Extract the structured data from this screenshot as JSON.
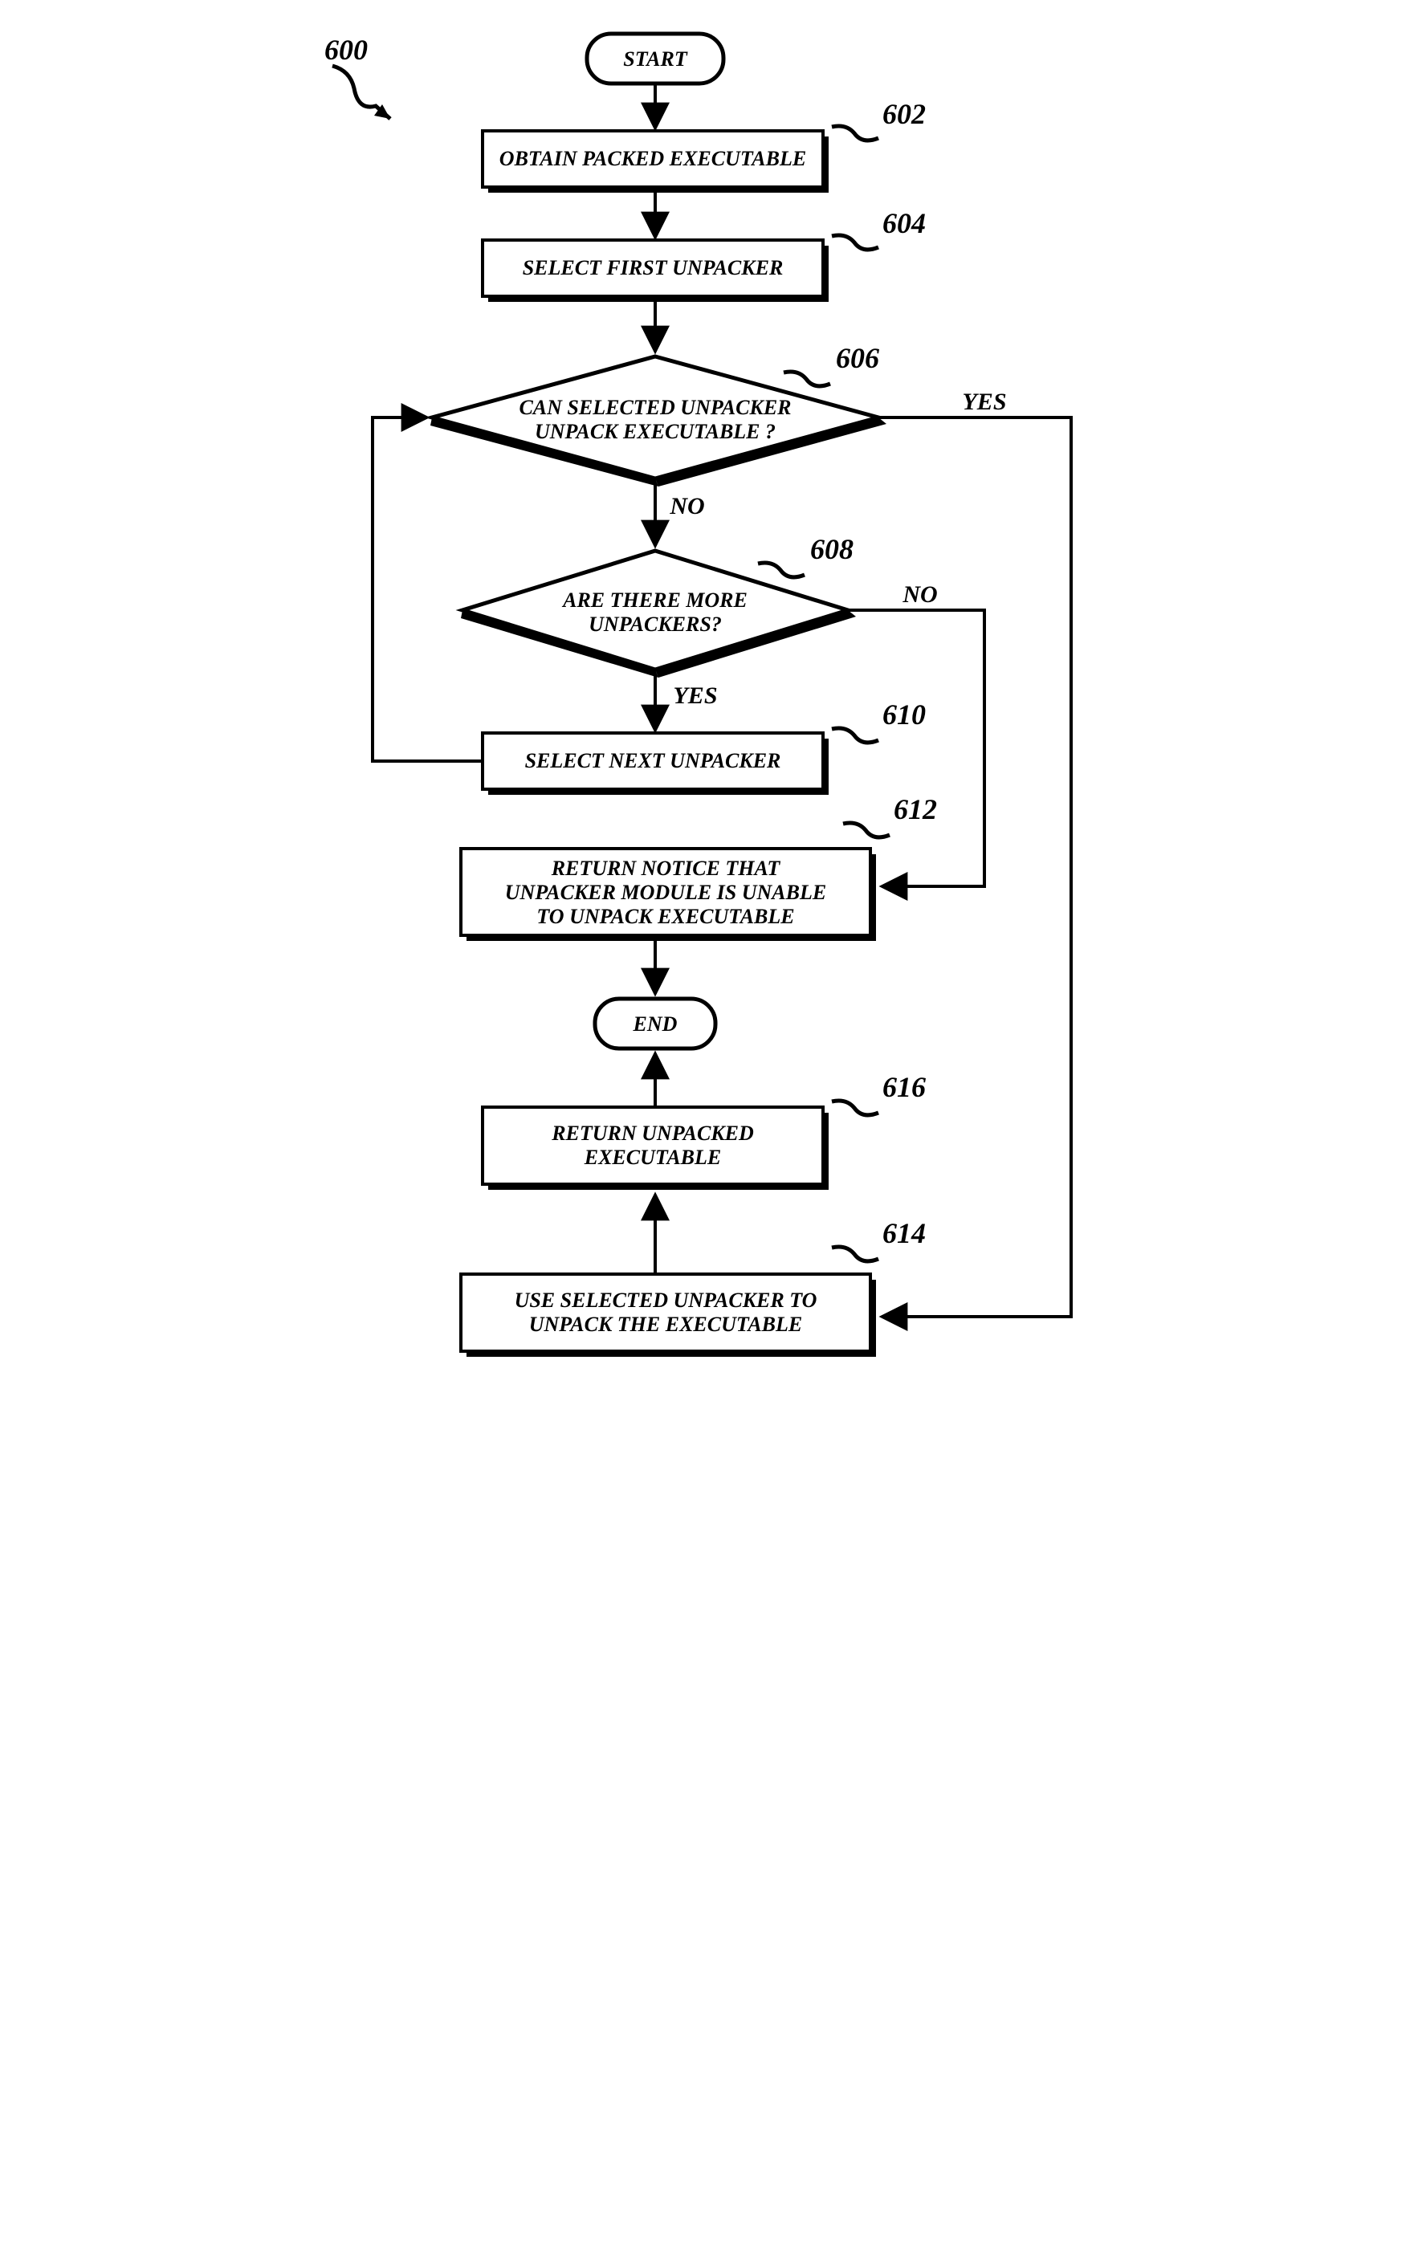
{
  "chart_data": {
    "type": "flowchart",
    "title_ref": "600",
    "nodes": {
      "start": {
        "label": "START",
        "type": "terminator"
      },
      "n602": {
        "label": "OBTAIN PACKED EXECUTABLE",
        "type": "process",
        "ref": "602"
      },
      "n604": {
        "label": "SELECT FIRST UNPACKER",
        "type": "process",
        "ref": "604"
      },
      "n606": {
        "label1": "CAN SELECTED UNPACKER",
        "label2": "UNPACK EXECUTABLE ?",
        "type": "decision",
        "ref": "606"
      },
      "n608": {
        "label1": "ARE THERE MORE",
        "label2": "UNPACKERS?",
        "type": "decision",
        "ref": "608"
      },
      "n610": {
        "label": "SELECT NEXT UNPACKER",
        "type": "process",
        "ref": "610"
      },
      "n612": {
        "label1": "RETURN NOTICE THAT",
        "label2": "UNPACKER MODULE IS UNABLE",
        "label3": "TO UNPACK EXECUTABLE",
        "type": "process",
        "ref": "612"
      },
      "end": {
        "label": "END",
        "type": "terminator"
      },
      "n616": {
        "label1": "RETURN UNPACKED",
        "label2": "EXECUTABLE",
        "type": "process",
        "ref": "616"
      },
      "n614": {
        "label1": "USE SELECTED UNPACKER TO",
        "label2": "UNPACK THE EXECUTABLE",
        "type": "process",
        "ref": "614"
      }
    },
    "edges": {
      "yes": "YES",
      "no": "NO"
    }
  }
}
